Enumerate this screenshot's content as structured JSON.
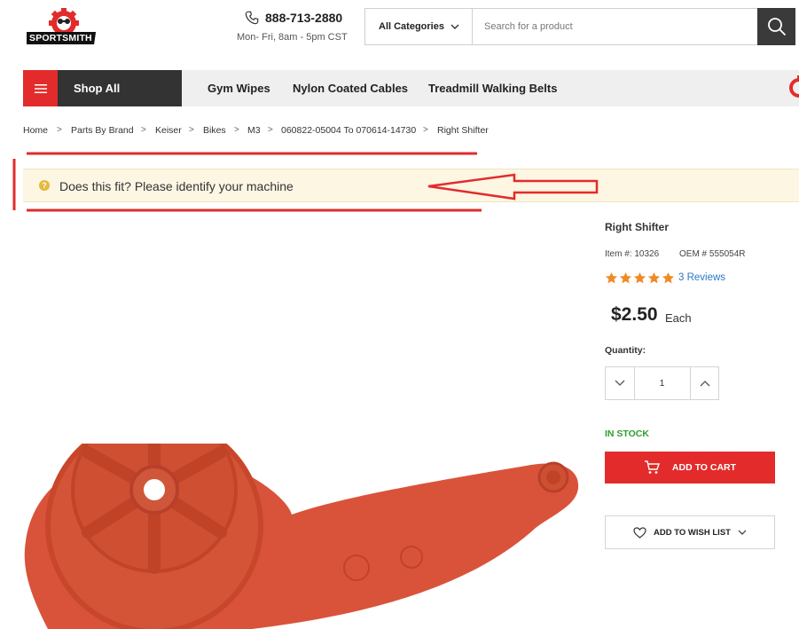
{
  "header": {
    "logo_text": "SPORTSMITH",
    "phone": "888-713-2880",
    "hours": "Mon- Fri, 8am - 5pm CST",
    "category_select": "All Categories",
    "search_placeholder": "Search for a product"
  },
  "nav": {
    "shop_all": "Shop All",
    "links": [
      "Gym Wipes",
      "Nylon Coated Cables",
      "Treadmill Walking Belts"
    ]
  },
  "breadcrumb": [
    "Home",
    "Parts By Brand",
    "Keiser",
    "Bikes",
    "M3",
    "060822-05004 To 070614-14730",
    "Right Shifter"
  ],
  "fit_alert": {
    "icon": "?",
    "text": "Does this fit? Please identify your machine"
  },
  "product": {
    "title": "Right Shifter",
    "item_label": "Item #:",
    "item_no": "10326",
    "oem_label": "OEM #",
    "oem_no": "555054R",
    "rating": 5,
    "reviews": "3 Reviews",
    "price": "$2.50",
    "unit": "Each",
    "quantity_label": "Quantity:",
    "quantity": "1",
    "stock": "IN STOCK",
    "add_to_cart": "ADD TO CART",
    "add_to_wishlist": "ADD TO WISH LIST"
  },
  "colors": {
    "brand_red": "#e32b2b",
    "nav_dark": "#333333",
    "stock_green": "#2da02d",
    "star_orange": "#f08a24",
    "link_blue": "#2a78c7",
    "alert_bg": "#fcf6e3"
  },
  "icons": [
    "phone-icon",
    "chevron-down-icon",
    "search-icon",
    "hamburger-icon",
    "question-icon",
    "star-icon",
    "minus-chevron-icon",
    "plus-chevron-icon",
    "cart-icon",
    "heart-icon"
  ]
}
